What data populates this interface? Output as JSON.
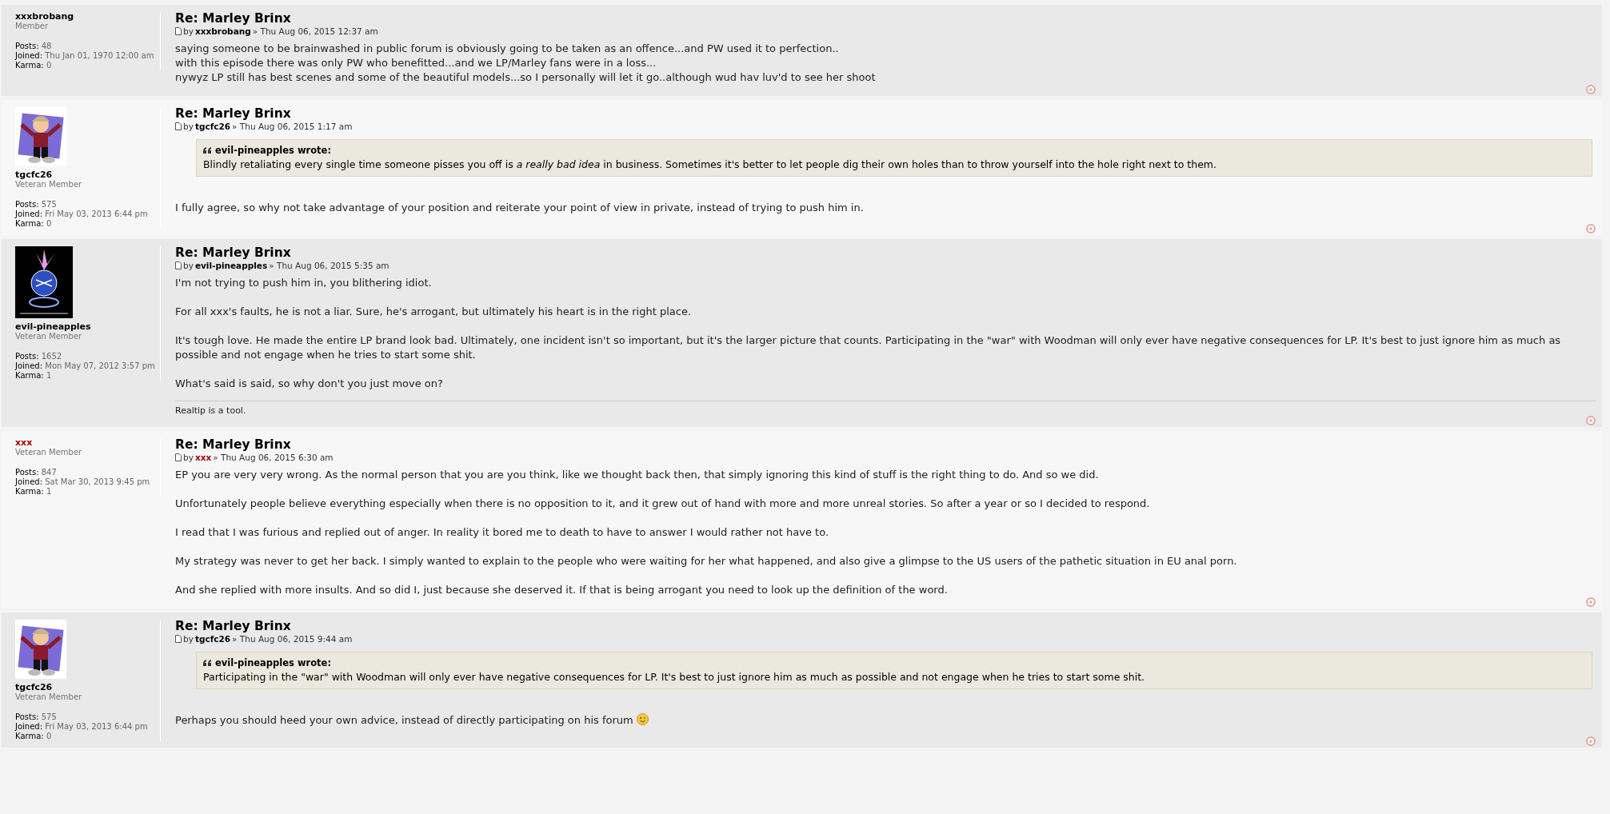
{
  "posts": [
    {
      "author": {
        "name": "xxxbrobang",
        "color": "#000000",
        "rank": "Member",
        "posts_label": "Posts:",
        "posts": "48",
        "joined_label": "Joined:",
        "joined": "Thu Jan 01, 1970 12:00 am",
        "karma_label": "Karma:",
        "karma": "0"
      },
      "title": "Re: Marley Brinx",
      "by": "by",
      "by_author": "xxxbrobang",
      "date": "» Thu Aug 06, 2015 12:37 am",
      "paragraphs": [
        "saying someone to be brainwashed in public forum is obviously going to be taken as an offence...and PW used it to perfection..\nwith this episode there was only PW who benefitted...and we LP/Marley fans were in a loss...\nnywyz LP still has best scenes and some of the beautiful models...so I personally will let it go..although wud hav luv'd to see her shoot"
      ]
    },
    {
      "author": {
        "name": "tgcfc26",
        "color": "#000000",
        "rank": "Veteran Member",
        "avatar": {
          "kind": "cartoon"
        },
        "posts_label": "Posts:",
        "posts": "575",
        "joined_label": "Joined:",
        "joined": "Fri May 03, 2013 6:44 pm",
        "karma_label": "Karma:",
        "karma": "0"
      },
      "title": "Re: Marley Brinx",
      "by": "by",
      "by_author": "tgcfc26",
      "date": "» Thu Aug 06, 2015 1:17 am",
      "quote": {
        "header": "evil-pineapples wrote:",
        "text": "Blindly retaliating every single time someone pisses you off is *a really bad idea* in business. Sometimes it's better to let people dig their own holes than to throw yourself into the hole right next to them."
      },
      "paragraphs": [
        "I fully agree, so why not take advantage of your position and reiterate your point of view in private, instead of trying to push him in."
      ]
    },
    {
      "author": {
        "name": "evil-pineapples",
        "color": "#000000",
        "rank": "Veteran Member",
        "avatar": {
          "kind": "pineapple"
        },
        "posts_label": "Posts:",
        "posts": "1652",
        "joined_label": "Joined:",
        "joined": "Mon May 07, 2012 3:57 pm",
        "karma_label": "Karma:",
        "karma": "1"
      },
      "title": "Re: Marley Brinx",
      "by": "by",
      "by_author": "evil-pineapples",
      "date": "» Thu Aug 06, 2015 5:35 am",
      "paragraphs": [
        "I'm not trying to push him in, you blithering idiot.",
        "For all xxx's faults, he is not a liar. Sure, he's arrogant, but ultimately his heart is in the right place.",
        "It's tough love. He made the entire LP brand look bad. Ultimately, one incident isn't so important, but it's the larger picture that counts. Participating in the \"war\" with Woodman will only ever have negative consequences for LP. It's best to just ignore him as much as possible and not engage when he tries to start some shit.",
        "What's said is said, so why don't you just move on?"
      ],
      "signature": "Realtip is a tool."
    },
    {
      "author": {
        "name": "xxx",
        "color": "#aa0000",
        "rank": "Veteran Member",
        "posts_label": "Posts:",
        "posts": "847",
        "joined_label": "Joined:",
        "joined": "Sat Mar 30, 2013 9:45 pm",
        "karma_label": "Karma:",
        "karma": "1"
      },
      "title": "Re: Marley Brinx",
      "by": "by",
      "by_author": "xxx",
      "date": "» Thu Aug 06, 2015 6:30 am",
      "paragraphs": [
        "EP you are very very wrong. As the normal person that you are you think, like we thought back then, that simply ignoring this kind of stuff is the right thing to do. And so we did.",
        "Unfortunately people believe everything especially when there is no opposition to it, and it grew out of hand with more and more unreal stories. So after a year or so I decided to respond.",
        "I read that I was furious and replied out of anger. In reality it bored me to death to have to answer I would rather not have to.",
        "My strategy was never to get her back. I simply wanted to explain to the people who were waiting for her what happened, and also give a glimpse to the US users of the pathetic situation in EU anal porn.",
        "And she replied with more insults. And so did I, just because she deserved it. If that is being arrogant you need to look up the definition of the word."
      ]
    },
    {
      "author": {
        "name": "tgcfc26",
        "color": "#000000",
        "rank": "Veteran Member",
        "avatar": {
          "kind": "cartoon"
        },
        "posts_label": "Posts:",
        "posts": "575",
        "joined_label": "Joined:",
        "joined": "Fri May 03, 2013 6:44 pm",
        "karma_label": "Karma:",
        "karma": "0"
      },
      "title": "Re: Marley Brinx",
      "by": "by",
      "by_author": "tgcfc26",
      "date": "» Thu Aug 06, 2015 9:44 am",
      "quote": {
        "header": "evil-pineapples wrote:",
        "text": "Participating in the \"war\" with Woodman will only ever have negative consequences for LP. It's best to just ignore him as much as possible and not engage when he tries to start some shit."
      },
      "paragraphs": [
        "Perhaps you should heed your own advice, instead of directly participating on his forum"
      ],
      "emoticon": {
        "kind": "wink"
      }
    }
  ]
}
